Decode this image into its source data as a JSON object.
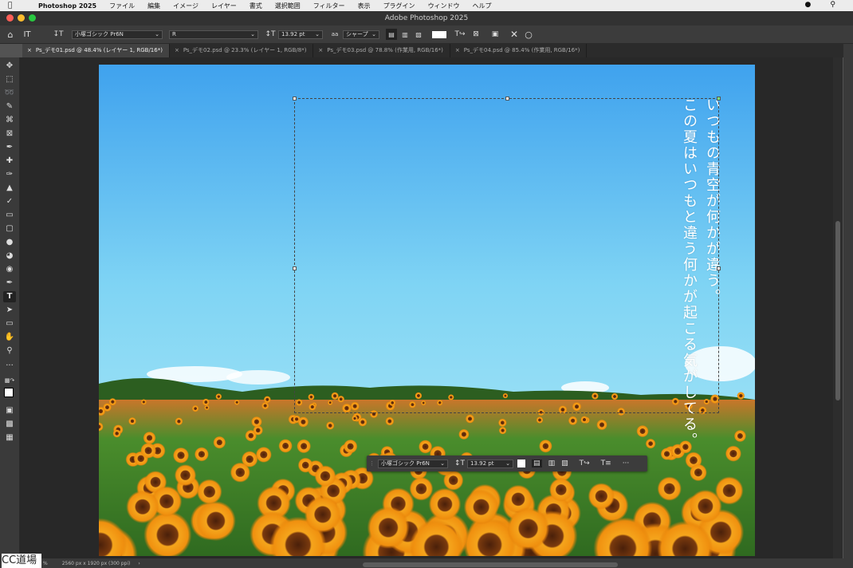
{
  "menubar": {
    "app": "Photoshop 2025",
    "items": [
      "ファイル",
      "編集",
      "イメージ",
      "レイヤー",
      "書式",
      "選択範囲",
      "フィルター",
      "表示",
      "プラグイン",
      "ウィンドウ",
      "ヘルプ"
    ]
  },
  "window_title": "Adobe Photoshop 2025",
  "options": {
    "font_family": "小塚ゴシック Pr6N",
    "font_style": "R",
    "font_size": "13.92 pt",
    "antialias": "シャープ"
  },
  "tabs": [
    {
      "label": "Ps_デモ01.psd @ 48.4% (レイヤー 1, RGB/16*)",
      "active": true
    },
    {
      "label": "Ps_デモ02.psd @ 23.3% (レイヤー 1, RGB/8*)",
      "active": false
    },
    {
      "label": "Ps_デモ03.psd @ 78.8% (作業用, RGB/16*)",
      "active": false
    },
    {
      "label": "Ps_デモ04.psd @ 85.4% (作業用, RGB/16*)",
      "active": false
    }
  ],
  "canvas_text": {
    "line1": "いつもの青空が何かが違う。",
    "line2": "この夏はいつもと違う何かが起こる気がしてる。"
  },
  "context_bar": {
    "font_family": "小塚ゴシック Pr6N",
    "font_size": "13.92 pt",
    "more": "···"
  },
  "status": {
    "zoom": "%",
    "doc_size": "2560 px x 1920 px (300 ppi)",
    "arrow": "›"
  },
  "watermark": "CC道場",
  "colors": {
    "sky_top": "#3fa2ee",
    "sky_bottom": "#a9e8f6",
    "foliage": "#3f8b2a",
    "petals": "#f0a21c"
  }
}
